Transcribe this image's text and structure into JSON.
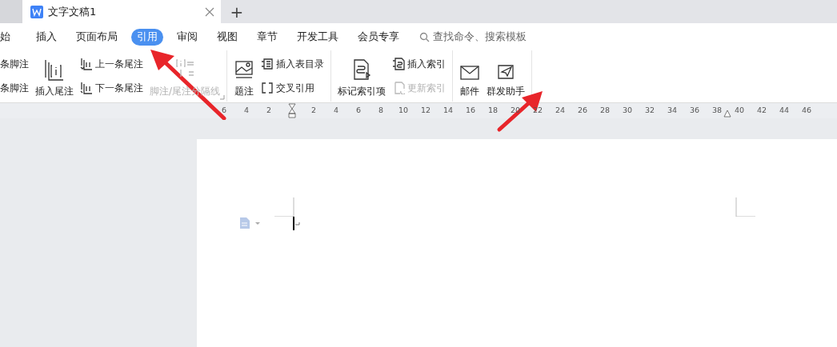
{
  "tab_bar": {
    "tabs": [
      {
        "title": "文字文稿1",
        "selected": true
      }
    ],
    "new_tab": "+"
  },
  "menu": [
    {
      "label": "始",
      "selected": false
    },
    {
      "label": "插入",
      "selected": false
    },
    {
      "label": "页面布局",
      "selected": false
    },
    {
      "label": "引用",
      "selected": true
    },
    {
      "label": "审阅",
      "selected": false
    },
    {
      "label": "视图",
      "selected": false
    },
    {
      "label": "章节",
      "selected": false
    },
    {
      "label": "开发工具",
      "selected": false
    },
    {
      "label": "会员专享",
      "selected": false
    }
  ],
  "search": {
    "placeholder": "查找命令、搜索模板"
  },
  "ribbon": {
    "groups": [
      {
        "columns": [
          {
            "kind": "stack",
            "items": [
              {
                "label": "条脚注",
                "disabled": false
              },
              {
                "label": "条脚注",
                "disabled": false
              }
            ]
          },
          {
            "kind": "large",
            "label": "插入尾注",
            "disabled": false
          },
          {
            "kind": "stack",
            "items": [
              {
                "label": "上一条尾注",
                "disabled": false
              },
              {
                "label": "下一条尾注",
                "disabled": false
              }
            ]
          },
          {
            "kind": "large",
            "label": "脚注/尾注分隔线",
            "disabled": true
          }
        ]
      },
      {
        "columns": [
          {
            "kind": "large",
            "label": "题注",
            "disabled": false
          },
          {
            "kind": "stack",
            "items": [
              {
                "label": "插入表目录",
                "disabled": false
              },
              {
                "label": "交叉引用",
                "disabled": false
              }
            ]
          }
        ]
      },
      {
        "columns": [
          {
            "kind": "large",
            "label": "标记索引项",
            "disabled": false
          },
          {
            "kind": "stack",
            "items": [
              {
                "label": "插入索引",
                "disabled": false
              },
              {
                "label": "更新索引",
                "disabled": true
              }
            ]
          }
        ]
      },
      {
        "columns": [
          {
            "kind": "large",
            "label": "邮件",
            "disabled": false
          },
          {
            "kind": "large",
            "label": "群发助手",
            "disabled": false
          }
        ]
      }
    ]
  },
  "ruler": {
    "labels": [
      "6",
      "4",
      "2",
      "2",
      "4",
      "6",
      "8",
      "10",
      "12",
      "14",
      "16",
      "18",
      "20",
      "22",
      "24",
      "26",
      "28",
      "30",
      "32",
      "34",
      "36",
      "38",
      "40",
      "42",
      "44",
      "46"
    ]
  }
}
